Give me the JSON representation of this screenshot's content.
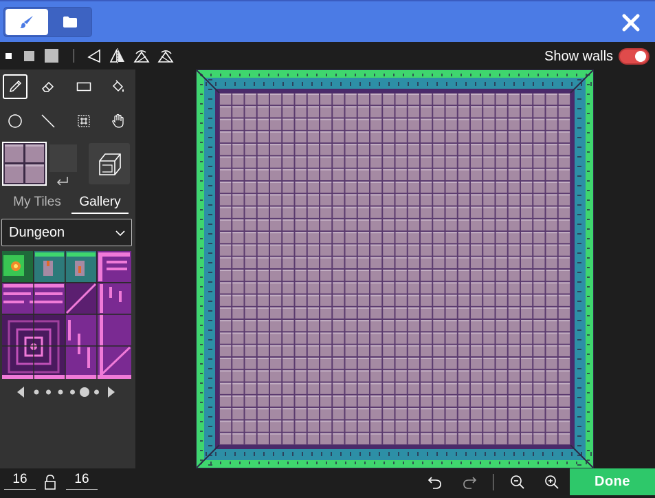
{
  "header": {
    "mode_buttons": [
      {
        "name": "paint",
        "icon": "paintbrush-icon",
        "selected": true
      },
      {
        "name": "assets",
        "icon": "folder-icon",
        "selected": false
      }
    ],
    "close_icon": "close-icon",
    "accent_color": "#4b7be5"
  },
  "toolbar": {
    "brush_sizes": [
      "small",
      "medium",
      "large"
    ],
    "transforms": [
      "rotate-icon",
      "flip-horizontal-icon",
      "rotate-cw-icon",
      "rotate-ccw-icon"
    ],
    "show_walls_label": "Show walls",
    "show_walls_on": true,
    "toggle_color": "#e04b4b"
  },
  "tools": [
    {
      "name": "pencil",
      "icon": "pencil-icon",
      "selected": true
    },
    {
      "name": "eraser",
      "icon": "eraser-icon",
      "selected": false
    },
    {
      "name": "rectangle",
      "icon": "rectangle-icon",
      "selected": false
    },
    {
      "name": "fill",
      "icon": "fill-bucket-icon",
      "selected": false
    },
    {
      "name": "circle",
      "icon": "circle-icon",
      "selected": false
    },
    {
      "name": "line",
      "icon": "line-icon",
      "selected": false
    },
    {
      "name": "marquee",
      "icon": "marquee-icon",
      "selected": false
    },
    {
      "name": "pan",
      "icon": "hand-icon",
      "selected": false
    }
  ],
  "palette": {
    "swap_icon": "swap-icon",
    "wall_icon": "wall-block-icon"
  },
  "tabs": [
    {
      "label": "My Tiles",
      "active": false
    },
    {
      "label": "Gallery",
      "active": true
    }
  ],
  "gallery": {
    "selected": "Dungeon",
    "page_count": 6,
    "current_page": 5
  },
  "map": {
    "width": "16",
    "height": "16",
    "floor_color": "#a58aa3",
    "wall_color": "#3fd66e"
  },
  "bottom": {
    "undo_icon": "undo-icon",
    "redo_icon": "redo-icon",
    "zoom_out_icon": "zoom-out-icon",
    "zoom_in_icon": "zoom-in-icon",
    "done_label": "Done",
    "done_color": "#2ec86a"
  }
}
